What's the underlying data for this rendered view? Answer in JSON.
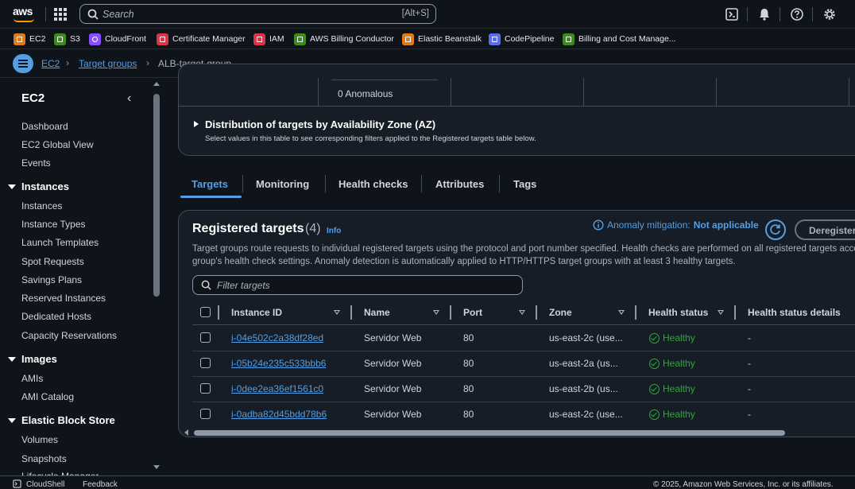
{
  "topbar": {
    "search_placeholder": "Search",
    "search_shortcut": "[Alt+S]"
  },
  "favorites": [
    {
      "label": "EC2",
      "color": "#e07b1a"
    },
    {
      "label": "S3",
      "color": "#3d8c1e"
    },
    {
      "label": "CloudFront",
      "color": "#8c4fff"
    },
    {
      "label": "Certificate Manager",
      "color": "#dd344c"
    },
    {
      "label": "IAM",
      "color": "#dd344c"
    },
    {
      "label": "AWS Billing Conductor",
      "color": "#3d8c1e"
    },
    {
      "label": "Elastic Beanstalk",
      "color": "#e07b1a"
    },
    {
      "label": "CodePipeline",
      "color": "#5a6cf0"
    },
    {
      "label": "Billing and Cost Manage...",
      "color": "#3d8c1e"
    }
  ],
  "breadcrumb": {
    "items": [
      "EC2",
      "Target groups",
      "ALB-target-group"
    ]
  },
  "sidebar": {
    "title": "EC2",
    "top_items": [
      "Dashboard",
      "EC2 Global View",
      "Events"
    ],
    "sections": [
      {
        "title": "Instances",
        "items": [
          "Instances",
          "Instance Types",
          "Launch Templates",
          "Spot Requests",
          "Savings Plans",
          "Reserved Instances",
          "Dedicated Hosts",
          "Capacity Reservations"
        ]
      },
      {
        "title": "Images",
        "items": [
          "AMIs",
          "AMI Catalog"
        ]
      },
      {
        "title": "Elastic Block Store",
        "items": [
          "Volumes",
          "Snapshots",
          "Lifecycle Manager"
        ]
      }
    ]
  },
  "summary": {
    "anomalous": "0 Anomalous",
    "az_title": "Distribution of targets by Availability Zone (AZ)",
    "az_desc": "Select values in this table to see corresponding filters applied to the Registered targets table below."
  },
  "tabs": [
    "Targets",
    "Monitoring",
    "Health checks",
    "Attributes",
    "Tags"
  ],
  "registered": {
    "title": "Registered targets",
    "count": "(4)",
    "info": "Info",
    "anomaly_label": "Anomaly mitigation:",
    "anomaly_value": "Not applicable",
    "deregister": "Deregister",
    "desc_line1": "Target groups route requests to individual registered targets using the protocol and port number specified. Health checks are performed on all registered targets according to the target",
    "desc_line2": "group's health check settings. Anomaly detection is automatically applied to HTTP/HTTPS target groups with at least 3 healthy targets.",
    "filter_placeholder": "Filter targets",
    "columns": [
      "Instance ID",
      "Name",
      "Port",
      "Zone",
      "Health status",
      "Health status details"
    ],
    "rows": [
      {
        "id": "i-04e502c2a38df28ed",
        "name": "Servidor Web",
        "port": "80",
        "zone": "us-east-2c (use...",
        "health": "Healthy",
        "details": "-"
      },
      {
        "id": "i-05b24e235c533bbb6",
        "name": "Servidor Web",
        "port": "80",
        "zone": "us-east-2a (us...",
        "health": "Healthy",
        "details": "-"
      },
      {
        "id": "i-0dee2ea36ef1561c0",
        "name": "Servidor Web",
        "port": "80",
        "zone": "us-east-2b (us...",
        "health": "Healthy",
        "details": "-"
      },
      {
        "id": "i-0adba82d45bdd78b6",
        "name": "Servidor Web",
        "port": "80",
        "zone": "us-east-2c (use...",
        "health": "Healthy",
        "details": "-"
      }
    ]
  },
  "footer": {
    "cloudshell": "CloudShell",
    "feedback": "Feedback",
    "copyright": "© 2025, Amazon Web Services, Inc. or its affiliates."
  }
}
